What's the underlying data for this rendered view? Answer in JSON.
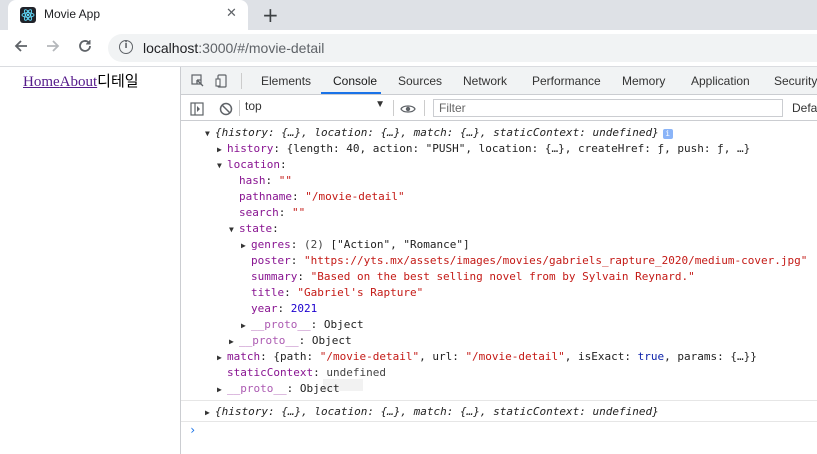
{
  "browser": {
    "tab_title": "Movie App",
    "url_host": "localhost",
    "url_rest": ":3000/#/movie-detail",
    "new_tab": "+",
    "close": "✕"
  },
  "page": {
    "link_home": "Home",
    "link_about": "About",
    "detail_text": "디테일"
  },
  "devtools": {
    "tabs": [
      "Elements",
      "Console",
      "Sources",
      "Network",
      "Performance",
      "Memory",
      "Application",
      "Security"
    ],
    "context": "top",
    "filter_placeholder": "Filter",
    "default_levels": "Defau"
  },
  "console": {
    "summary": "{history: {…}, location: {…}, match: {…}, staticContext: undefined}",
    "history_key": "history",
    "history_val": "{length: 40, action: \"PUSH\", location: {…}, createHref: ƒ, push: ƒ, …}",
    "location_key": "location",
    "hash_key": "hash",
    "hash_val": "\"\"",
    "pathname_key": "pathname",
    "pathname_val": "\"/movie-detail\"",
    "search_key": "search",
    "search_val": "\"\"",
    "state_key": "state",
    "genres_key": "genres",
    "genres_count": "(2)",
    "genres_val": "[\"Action\", \"Romance\"]",
    "poster_key": "poster",
    "poster_val": "\"https://yts.mx/assets/images/movies/gabriels_rapture_2020/medium-cover.jpg\"",
    "summary_key": "summary",
    "summary_val": "\"Based on the best selling novel from by Sylvain Reynard.\"",
    "title_key": "title",
    "title_val": "\"Gabriel's Rapture\"",
    "year_key": "year",
    "year_val": "2021",
    "proto_key": "__proto__",
    "proto_val": "Object",
    "match_key": "match",
    "match_val": "{path: \"/movie-detail\", url: \"/movie-detail\", isExact: true, params: {…}}",
    "static_key": "staticContext",
    "static_val": "undefined",
    "summary2": "{history: {…}, location: {…}, match: {…}, staticContext: undefined}",
    "prompt": "›",
    "info_badge": "i"
  },
  "colors": {
    "tabstrip": "#dee1e6",
    "accent": "#1a73e8",
    "key": "#881391",
    "string": "#c41a16",
    "number": "#1c00cf"
  }
}
